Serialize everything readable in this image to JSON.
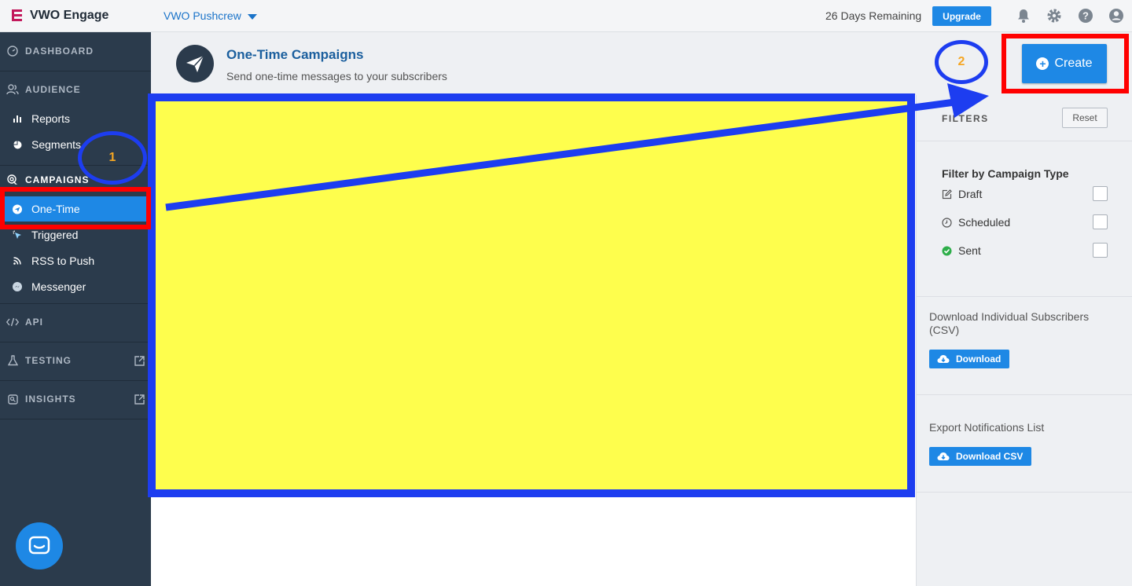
{
  "topbar": {
    "app_name": "VWO Engage",
    "account_name": "VWO Pushcrew",
    "days_remaining": "26 Days Remaining",
    "upgrade_label": "Upgrade"
  },
  "sidebar": {
    "dashboard": "DASHBOARD",
    "audience": "AUDIENCE",
    "audience_items": [
      "Reports",
      "Segments"
    ],
    "campaigns": "CAMPAIGNS",
    "campaign_items": [
      "One-Time",
      "Triggered",
      "RSS to Push",
      "Messenger"
    ],
    "api": "API",
    "testing": "TESTING",
    "insights": "INSIGHTS",
    "selected_item": "One-Time"
  },
  "header": {
    "title": "One-Time Campaigns",
    "subtitle": "Send one-time messages to your subscribers",
    "create_label": "Create"
  },
  "filters": {
    "label": "FILTERS",
    "reset_label": "Reset",
    "heading": "Filter by Campaign Type",
    "options": [
      {
        "label": "Draft",
        "checked": false
      },
      {
        "label": "Scheduled",
        "checked": false
      },
      {
        "label": "Sent",
        "checked": false
      }
    ]
  },
  "downloads": {
    "subscribers_text": "Download Individual Subscribers (CSV)",
    "download_label": "Download",
    "export_text": "Export Notifications List",
    "download_csv_label": "Download CSV"
  },
  "annotations": {
    "step_1": "1",
    "step_2": "2"
  },
  "colors": {
    "primary": "#1e88e5",
    "sidebar_bg": "#2b3b4c",
    "annotation_red": "#ff0000",
    "annotation_blue": "#1d3df0",
    "highlight_yellow": "#fefe4d",
    "step_number": "#f5a623"
  }
}
